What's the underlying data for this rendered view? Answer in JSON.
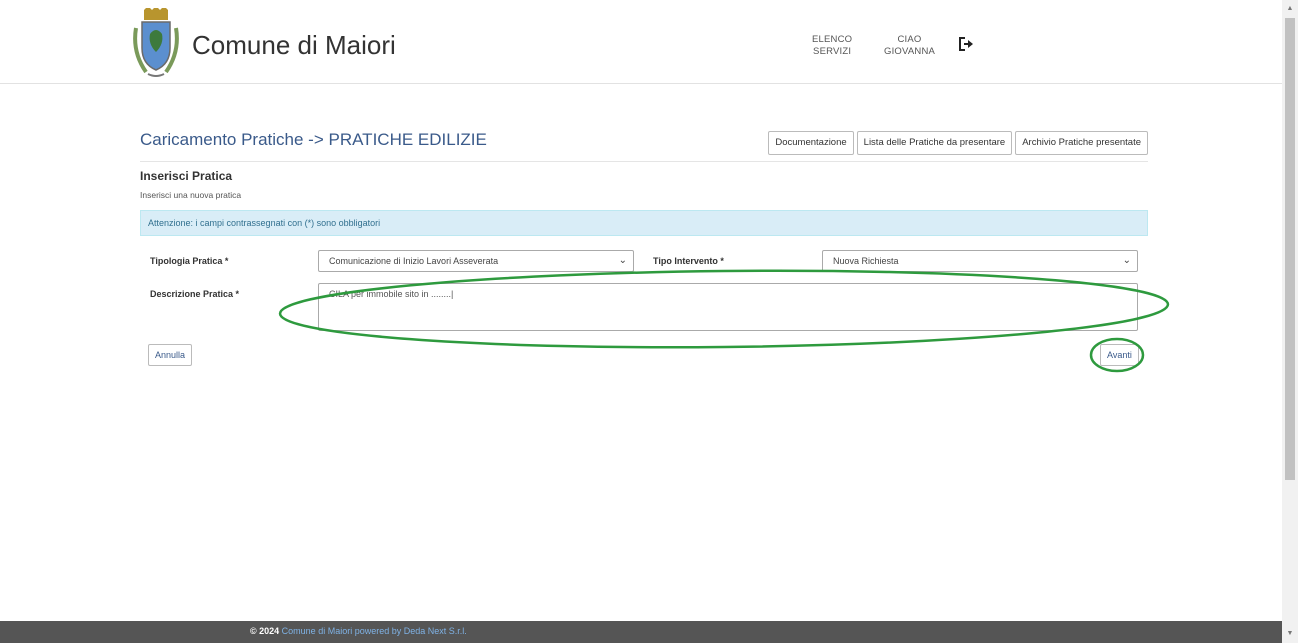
{
  "header": {
    "site_title": "Comune di Maiori",
    "nav_services_line1": "ELENCO",
    "nav_services_line2": "SERVIZI",
    "nav_user_line1": "CIAO",
    "nav_user_line2": "GIOVANNA",
    "logout_icon": "logout-icon"
  },
  "page": {
    "title": "Caricamento Pratiche -> PRATICHE EDILIZIE",
    "buttons": {
      "documentazione": "Documentazione",
      "lista": "Lista delle Pratiche da presentare",
      "archivio": "Archivio Pratiche presentate"
    },
    "section_title": "Inserisci Pratica",
    "section_subtitle": "Inserisci una nuova pratica",
    "alert": "Attenzione: i campi contrassegnati con (*) sono obbligatori"
  },
  "form": {
    "tipologia_label": "Tipologia Pratica *",
    "tipologia_value": "Comunicazione di Inizio Lavori Asseverata",
    "tipo_intervento_label": "Tipo Intervento *",
    "tipo_intervento_value": "Nuova Richiesta",
    "descrizione_label": "Descrizione Pratica *",
    "descrizione_value": "CILA per immobile sito in ........|",
    "annulla": "Annulla",
    "avanti": "Avanti"
  },
  "annotation_color": "#2e9a3e",
  "footer": {
    "copyright": "© 2024",
    "link": "Comune di Maiori powered by Deda Next S.r.l."
  }
}
